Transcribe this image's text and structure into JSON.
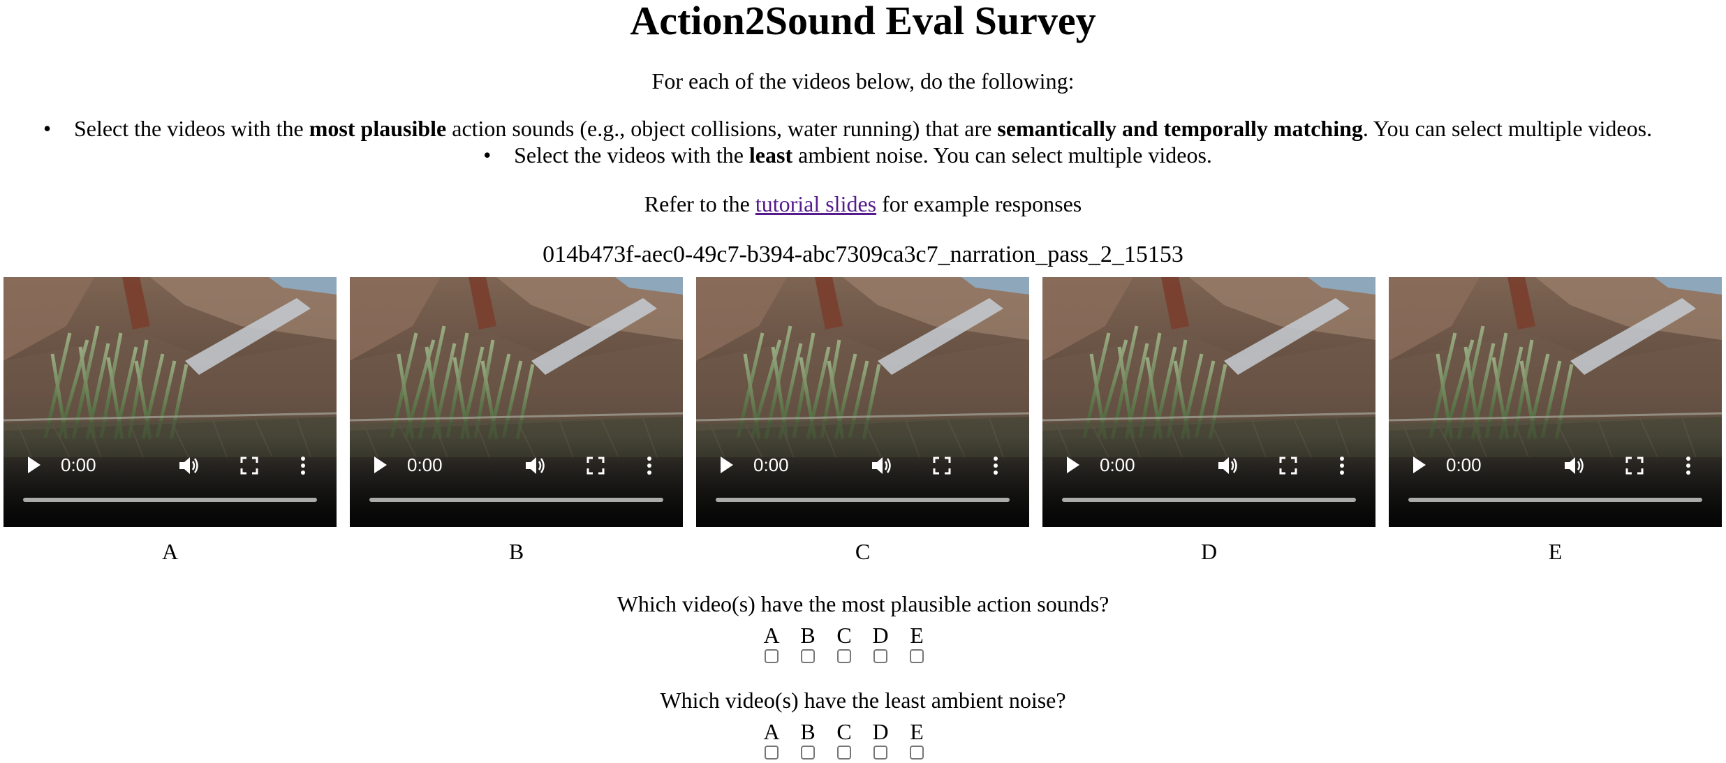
{
  "title": "Action2Sound Eval Survey",
  "intro": "For each of the videos below, do the following:",
  "instructions": [
    {
      "pre": "Select the videos with the ",
      "bold1": "most plausible",
      "mid": " action sounds (e.g., object collisions, water running) that are ",
      "bold2": "semantically and temporally matching",
      "post": ". You can select multiple videos."
    },
    {
      "pre": "Select the videos with the ",
      "bold1": "least",
      "post": " ambient noise. You can select multiple videos."
    }
  ],
  "refer": {
    "pre": "Refer to the ",
    "link": "tutorial slides",
    "post": " for example responses"
  },
  "clip_id": "014b473f-aec0-49c7-b394-abc7309ca3c7_narration_pass_2_15153",
  "videos": [
    {
      "label": "A",
      "time": "0:00",
      "progress": 0
    },
    {
      "label": "B",
      "time": "0:00",
      "progress": 0
    },
    {
      "label": "C",
      "time": "0:00",
      "progress": 0
    },
    {
      "label": "D",
      "time": "0:00",
      "progress": 0
    },
    {
      "label": "E",
      "time": "0:00",
      "progress": 0
    }
  ],
  "questions": [
    {
      "text": "Which video(s) have the most plausible action sounds?",
      "options": [
        "A",
        "B",
        "C",
        "D",
        "E"
      ],
      "checked": [
        false,
        false,
        false,
        false,
        false
      ]
    },
    {
      "text": "Which video(s) have the least ambient noise?",
      "options": [
        "A",
        "B",
        "C",
        "D",
        "E"
      ],
      "checked": [
        false,
        false,
        false,
        false,
        false
      ]
    }
  ],
  "icons": {
    "play": "play-icon",
    "volume": "volume-icon",
    "fullscreen": "fullscreen-icon",
    "more": "more-options-icon"
  },
  "colors": {
    "link_visited": "#551a8b",
    "checkbox_border": "#767676"
  }
}
